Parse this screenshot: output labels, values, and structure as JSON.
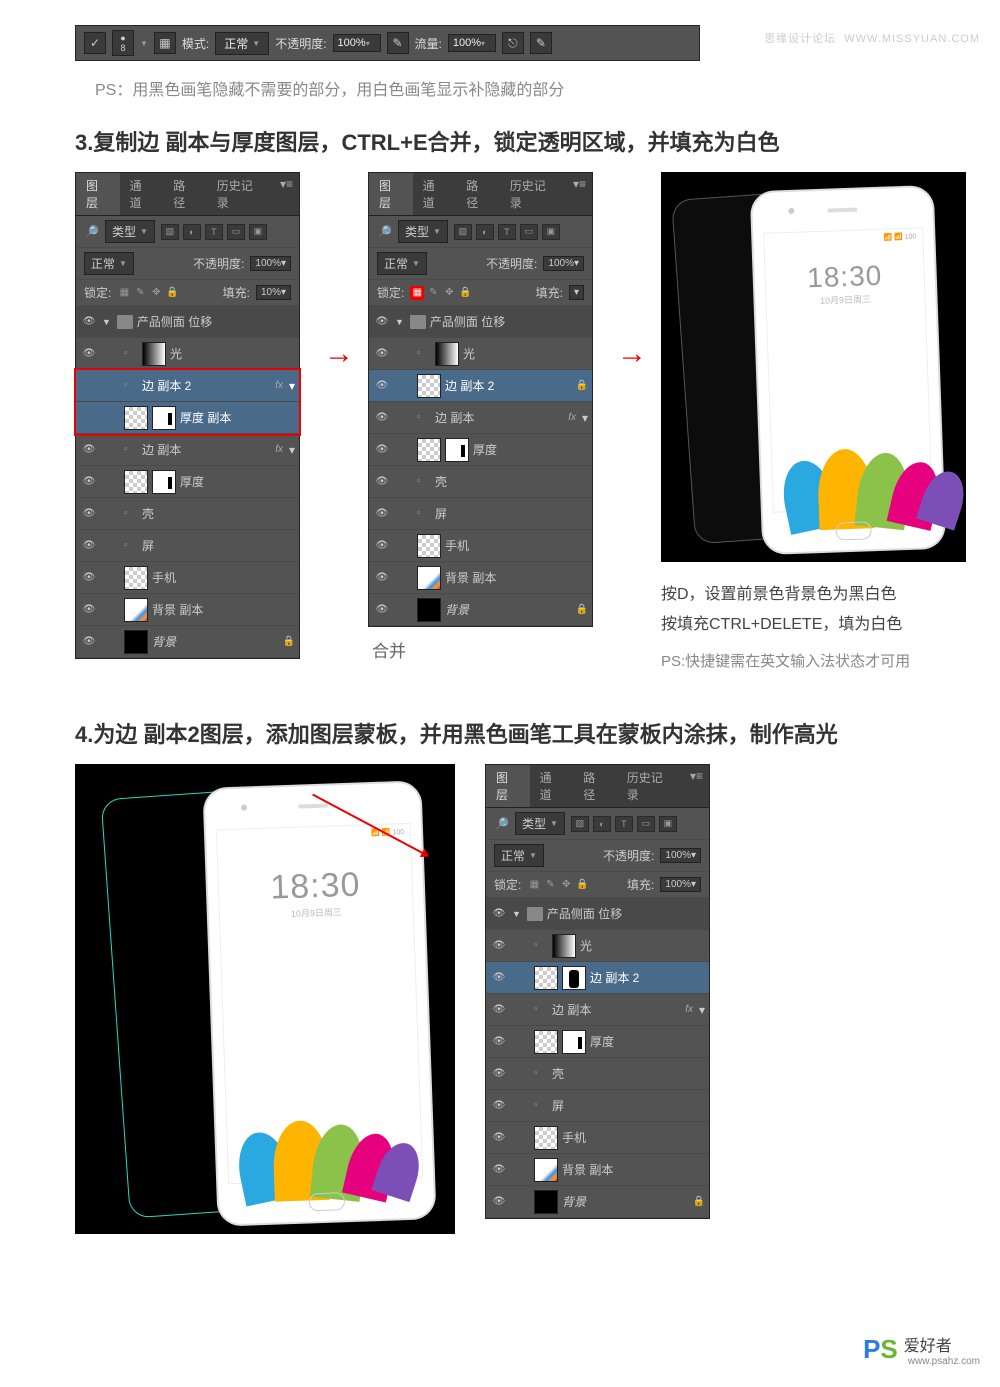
{
  "watermarks": {
    "top_left": "思缘设计论坛",
    "top_right": "WWW.MISSYUAN.COM",
    "bottom_logo_p": "P",
    "bottom_logo_s": "S",
    "bottom_cn": "爱好者",
    "bottom_url": "www.psahz.com"
  },
  "toolbar": {
    "brush_size": "8",
    "mode_label": "模式:",
    "mode_value": "正常",
    "opacity_label": "不透明度:",
    "opacity_value": "100%",
    "flow_label": "流量:",
    "flow_value": "100%"
  },
  "step_ps_note": "PS：用黑色画笔隐藏不需要的部分，用白色画笔显示补隐藏的部分",
  "step3_title": "3.复制边 副本与厚度图层，CTRL+E合并，锁定透明区域，并填充为白色",
  "step4_title": "4.为边 副本2图层，添加图层蒙板，并用黑色画笔工具在蒙板内涂抹，制作高光",
  "panel_common": {
    "tab_layers": "图层",
    "tab_channels": "通道",
    "tab_paths": "路径",
    "tab_history": "历史记录",
    "kind_label": "类型",
    "blend_normal": "正常",
    "opacity_label": "不透明度:",
    "lock_label": "锁定:",
    "fill_label": "填充:"
  },
  "panel1": {
    "opacity": "100%",
    "fill": "10%",
    "group": "产品侧面 位移",
    "layers": [
      "光",
      "边 副本 2",
      "厚度 副本",
      "边 副本",
      "厚度",
      "壳",
      "屏",
      "手机",
      "背景 副本",
      "背景"
    ]
  },
  "panel2": {
    "opacity": "100%",
    "fill": "",
    "group": "产品侧面 位移",
    "layers": [
      "光",
      "边 副本 2",
      "边 副本",
      "厚度",
      "壳",
      "屏",
      "手机",
      "背景 副本",
      "背景"
    ],
    "caption": "合并"
  },
  "panel3": {
    "opacity": "100%",
    "fill": "100%",
    "group": "产品侧面 位移",
    "layers": [
      "光",
      "边 副本 2",
      "边 副本",
      "厚度",
      "壳",
      "屏",
      "手机",
      "背景 副本",
      "背景"
    ]
  },
  "phone": {
    "time": "18:30",
    "date": "10月9日周三",
    "status": "📶 📶 100"
  },
  "side_notes": {
    "l1": "按D，设置前景色背景色为黑白色",
    "l2": "按填充CTRL+DELETE，填为白色",
    "hint": "PS:快捷键需在英文输入法状态才可用"
  }
}
